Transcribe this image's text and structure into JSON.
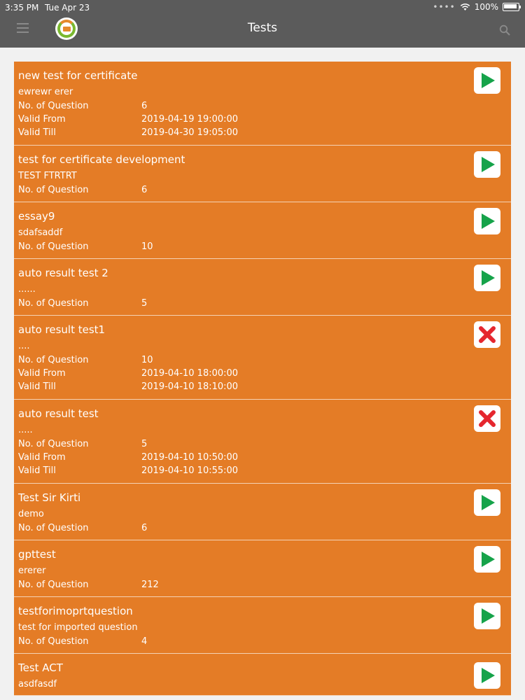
{
  "status_bar": {
    "time": "3:35 PM",
    "date": "Tue Apr 23",
    "signal": "••••",
    "battery": "100%"
  },
  "header": {
    "title": "Tests",
    "menu_icon": "hamburger-icon",
    "search_icon": "search-icon",
    "logo_icon": "app-logo"
  },
  "labels": {
    "questions": "No. of Question",
    "valid_from": "Valid From",
    "valid_till": "Valid Till"
  },
  "colors": {
    "card": "#e47c26",
    "header": "#5b5b5b",
    "play": "#16a34a",
    "closed": "#e5262e"
  },
  "tests": [
    {
      "title": "new test for certificate",
      "description": "ewrewr erer",
      "questions": "6",
      "valid_from": "2019-04-19 19:00:00",
      "valid_till": "2019-04-30 19:05:00",
      "action": "play"
    },
    {
      "title": "test for certificate development",
      "description": "TEST FTRTRT",
      "questions": "6",
      "action": "play"
    },
    {
      "title": "essay9",
      "description": "sdafsaddf",
      "questions": "10",
      "action": "play"
    },
    {
      "title": "auto result test 2",
      "description": "......",
      "questions": "5",
      "action": "play"
    },
    {
      "title": "auto result test1",
      "description": "....",
      "questions": "10",
      "valid_from": "2019-04-10 18:00:00",
      "valid_till": "2019-04-10 18:10:00",
      "action": "closed"
    },
    {
      "title": "auto result test",
      "description": ".....",
      "questions": "5",
      "valid_from": "2019-04-10 10:50:00",
      "valid_till": "2019-04-10 10:55:00",
      "action": "closed"
    },
    {
      "title": "Test Sir Kirti",
      "description": "demo",
      "questions": "6",
      "action": "play"
    },
    {
      "title": "gpttest",
      "description": "ererer",
      "questions": "212",
      "action": "play"
    },
    {
      "title": "testforimoprtquestion",
      "description": "test for imported question",
      "questions": "4",
      "action": "play"
    },
    {
      "title": " Test ACT",
      "description": "asdfasdf",
      "action": "play"
    }
  ]
}
